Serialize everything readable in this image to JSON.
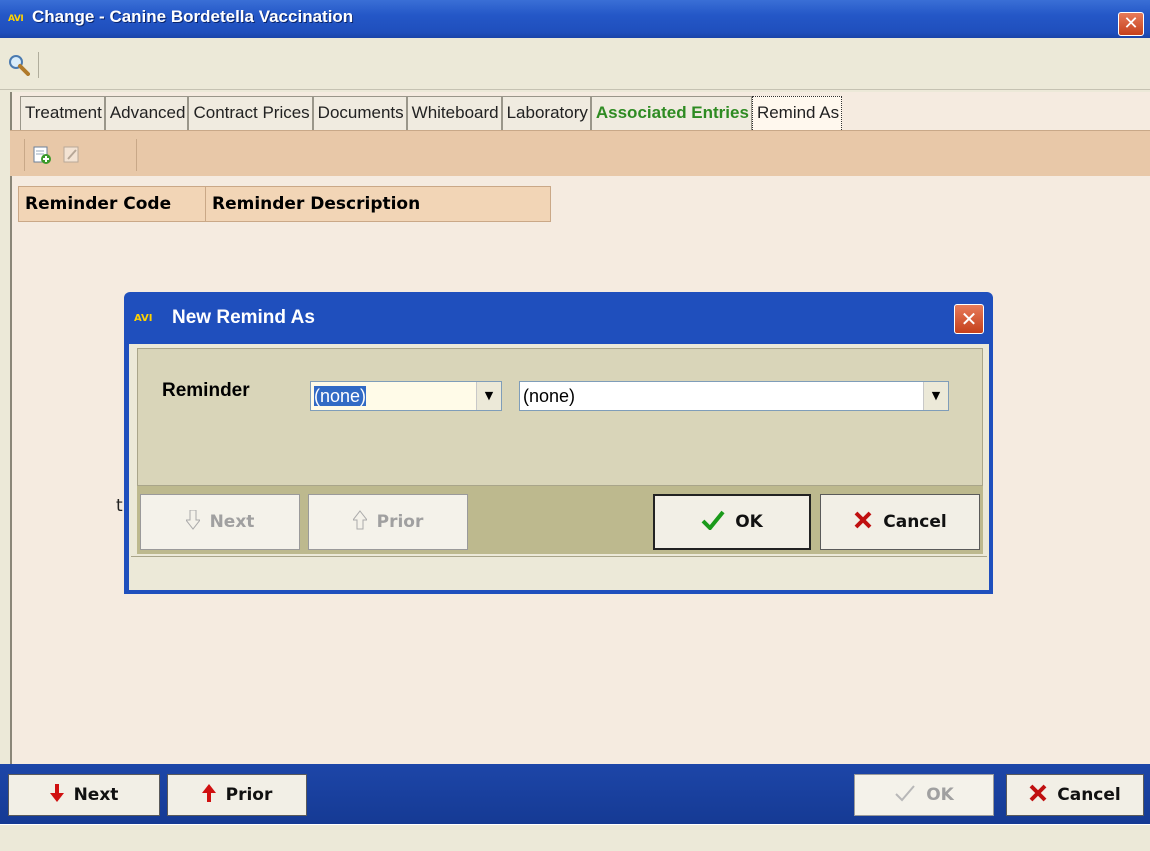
{
  "window": {
    "logo_text": "AVI",
    "title": "Change - Canine Bordetella Vaccination",
    "close_glyph": "✕"
  },
  "tabs": [
    {
      "label": "Treatment",
      "style": "normal"
    },
    {
      "label": "Advanced",
      "style": "normal"
    },
    {
      "label": "Contract Prices",
      "style": "normal"
    },
    {
      "label": "Documents",
      "style": "normal"
    },
    {
      "label": "Whiteboard",
      "style": "normal"
    },
    {
      "label": "Laboratory",
      "style": "normal"
    },
    {
      "label": "Associated Entries",
      "style": "green"
    },
    {
      "label": "Remind As",
      "style": "active"
    }
  ],
  "grid": {
    "columns": [
      "Reminder Code",
      "Reminder Description"
    ]
  },
  "stray_text": "t",
  "bottom_buttons": {
    "next": "Next",
    "prior": "Prior",
    "ok": "OK",
    "cancel": "Cancel"
  },
  "dialog": {
    "logo_text": "AVI",
    "title": "New Remind As",
    "close_glyph": "✕",
    "reminder_label": "Reminder",
    "reminder_code_value": "(none)",
    "reminder_description_value": "(none)",
    "buttons": {
      "next": "Next",
      "prior": "Prior",
      "ok": "OK",
      "cancel": "Cancel"
    }
  },
  "colors": {
    "title_bar": "#2457c7",
    "form_background": "#f5ebe0",
    "tab_strip": "#e8c8a8",
    "associated_entries_green": "#2e8b22",
    "close_button_red": "#c5401c"
  },
  "icons": [
    "app-logo-icon",
    "close-icon",
    "search-icon",
    "new-record-icon",
    "edit-record-icon",
    "arrow-down-icon",
    "arrow-up-icon",
    "check-icon",
    "x-icon",
    "dropdown-arrow-icon"
  ]
}
